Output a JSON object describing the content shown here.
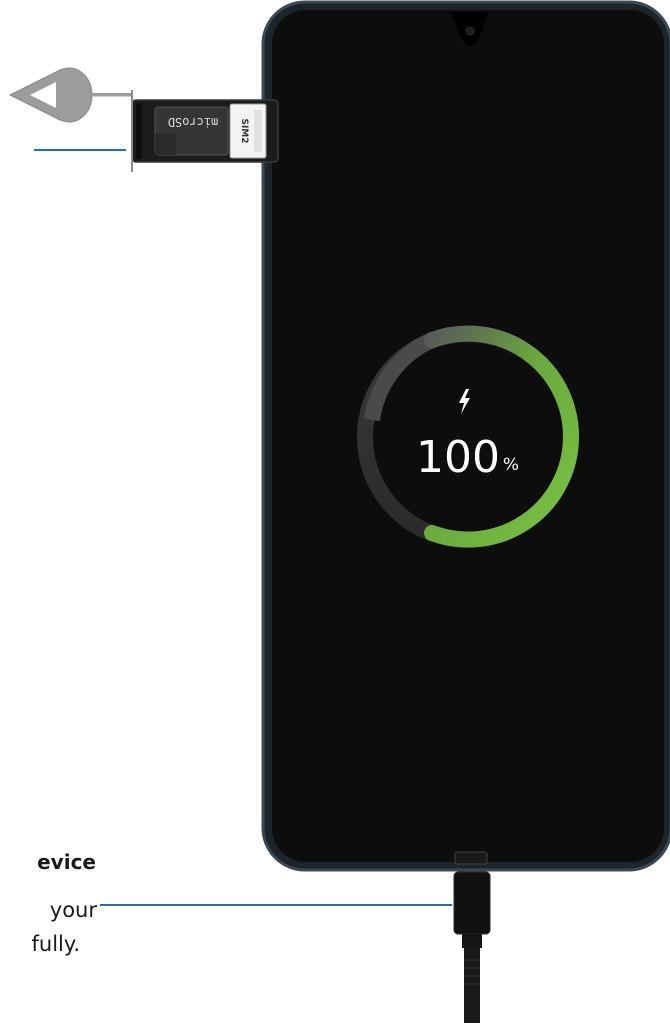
{
  "tray": {
    "microsd_label": "microSD",
    "sim_label": "SIM2"
  },
  "screen": {
    "battery_value": "100",
    "battery_unit": "%",
    "battery_level": 1.0,
    "bolt_icon": "lightning-bolt-icon"
  },
  "callout": {
    "heading": "evice",
    "line1": "your",
    "line2": "fully."
  },
  "colors": {
    "callout_line": "#1f6fa8",
    "ring_green": "#7ac143",
    "phone_body": "#0c0c0c",
    "phone_frame": "#2c3640"
  }
}
